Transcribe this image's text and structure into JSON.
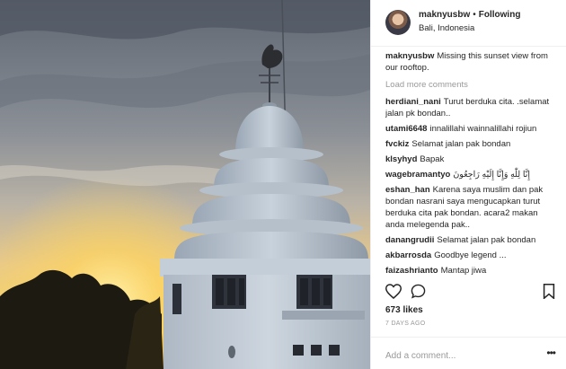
{
  "post": {
    "username": "maknyusbw",
    "follow_status": "Following",
    "separator": "•",
    "location": "Bali, Indonesia",
    "caption": "Missing this sunset view from our rooftop.",
    "load_more": "Load more comments",
    "likes": "673 likes",
    "timestamp": "7 DAYS AGO",
    "add_comment_placeholder": "Add a comment...",
    "more_options": "•••"
  },
  "comments": [
    {
      "user": "herdiani_nani",
      "text": "Turut berduka cita. .selamat jalan pk bondan.."
    },
    {
      "user": "utami6648",
      "text": "innalillahi wainnalillahi rojiun"
    },
    {
      "user": "fvckiz",
      "text": "Selamat jalan pak bondan"
    },
    {
      "user": "klsyhyd",
      "text": "Bapak"
    },
    {
      "user": "wagebramantyo",
      "text": "إِنَّا لِلّٰهِ وَإِنَّا إِلَيْهِ رَاجِعُونَ"
    },
    {
      "user": "eshan_han",
      "text": "Karena saya muslim dan pak bondan nasrani saya mengucapkan turut berduka cita pak bondan. acara2 makan anda melegenda pak.."
    },
    {
      "user": "danangrudii",
      "text": "Selamat jalan pak bondan"
    },
    {
      "user": "akbarrosda",
      "text": "Goodbye legend ..."
    },
    {
      "user": "faizashrianto",
      "text": "Mantap jiwa"
    }
  ],
  "icons": {
    "like": "heart-icon",
    "comment": "comment-icon",
    "save": "bookmark-icon"
  },
  "colors": {
    "muted": "#999999",
    "text": "#262626",
    "border": "#efefef"
  }
}
